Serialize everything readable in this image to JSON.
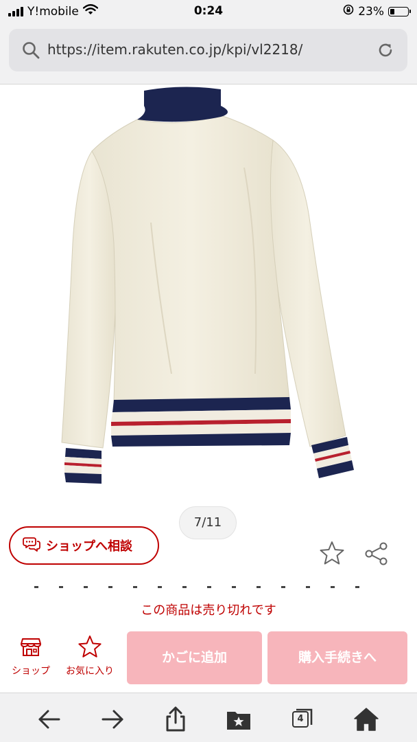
{
  "status_bar": {
    "carrier": "Y!mobile",
    "time": "0:24",
    "battery": "23%"
  },
  "url_bar": {
    "url": "https://item.rakuten.co.jp/kpi/vl2218/"
  },
  "gallery": {
    "counter": "7/11"
  },
  "actions": {
    "consult_label": "ショップへ相談"
  },
  "purchase": {
    "soldout": "この商品は売り切れです",
    "shop_label": "ショップ",
    "favorite_label": "お気に入り",
    "cart_label": "かごに追加",
    "buy_label": "購入手続きへ"
  },
  "toolbar": {
    "tab_count": "4"
  },
  "colors": {
    "brand_red": "#bf0000",
    "disabled_button": "#f7b5bb",
    "chrome_bg": "#f1f1f2"
  }
}
